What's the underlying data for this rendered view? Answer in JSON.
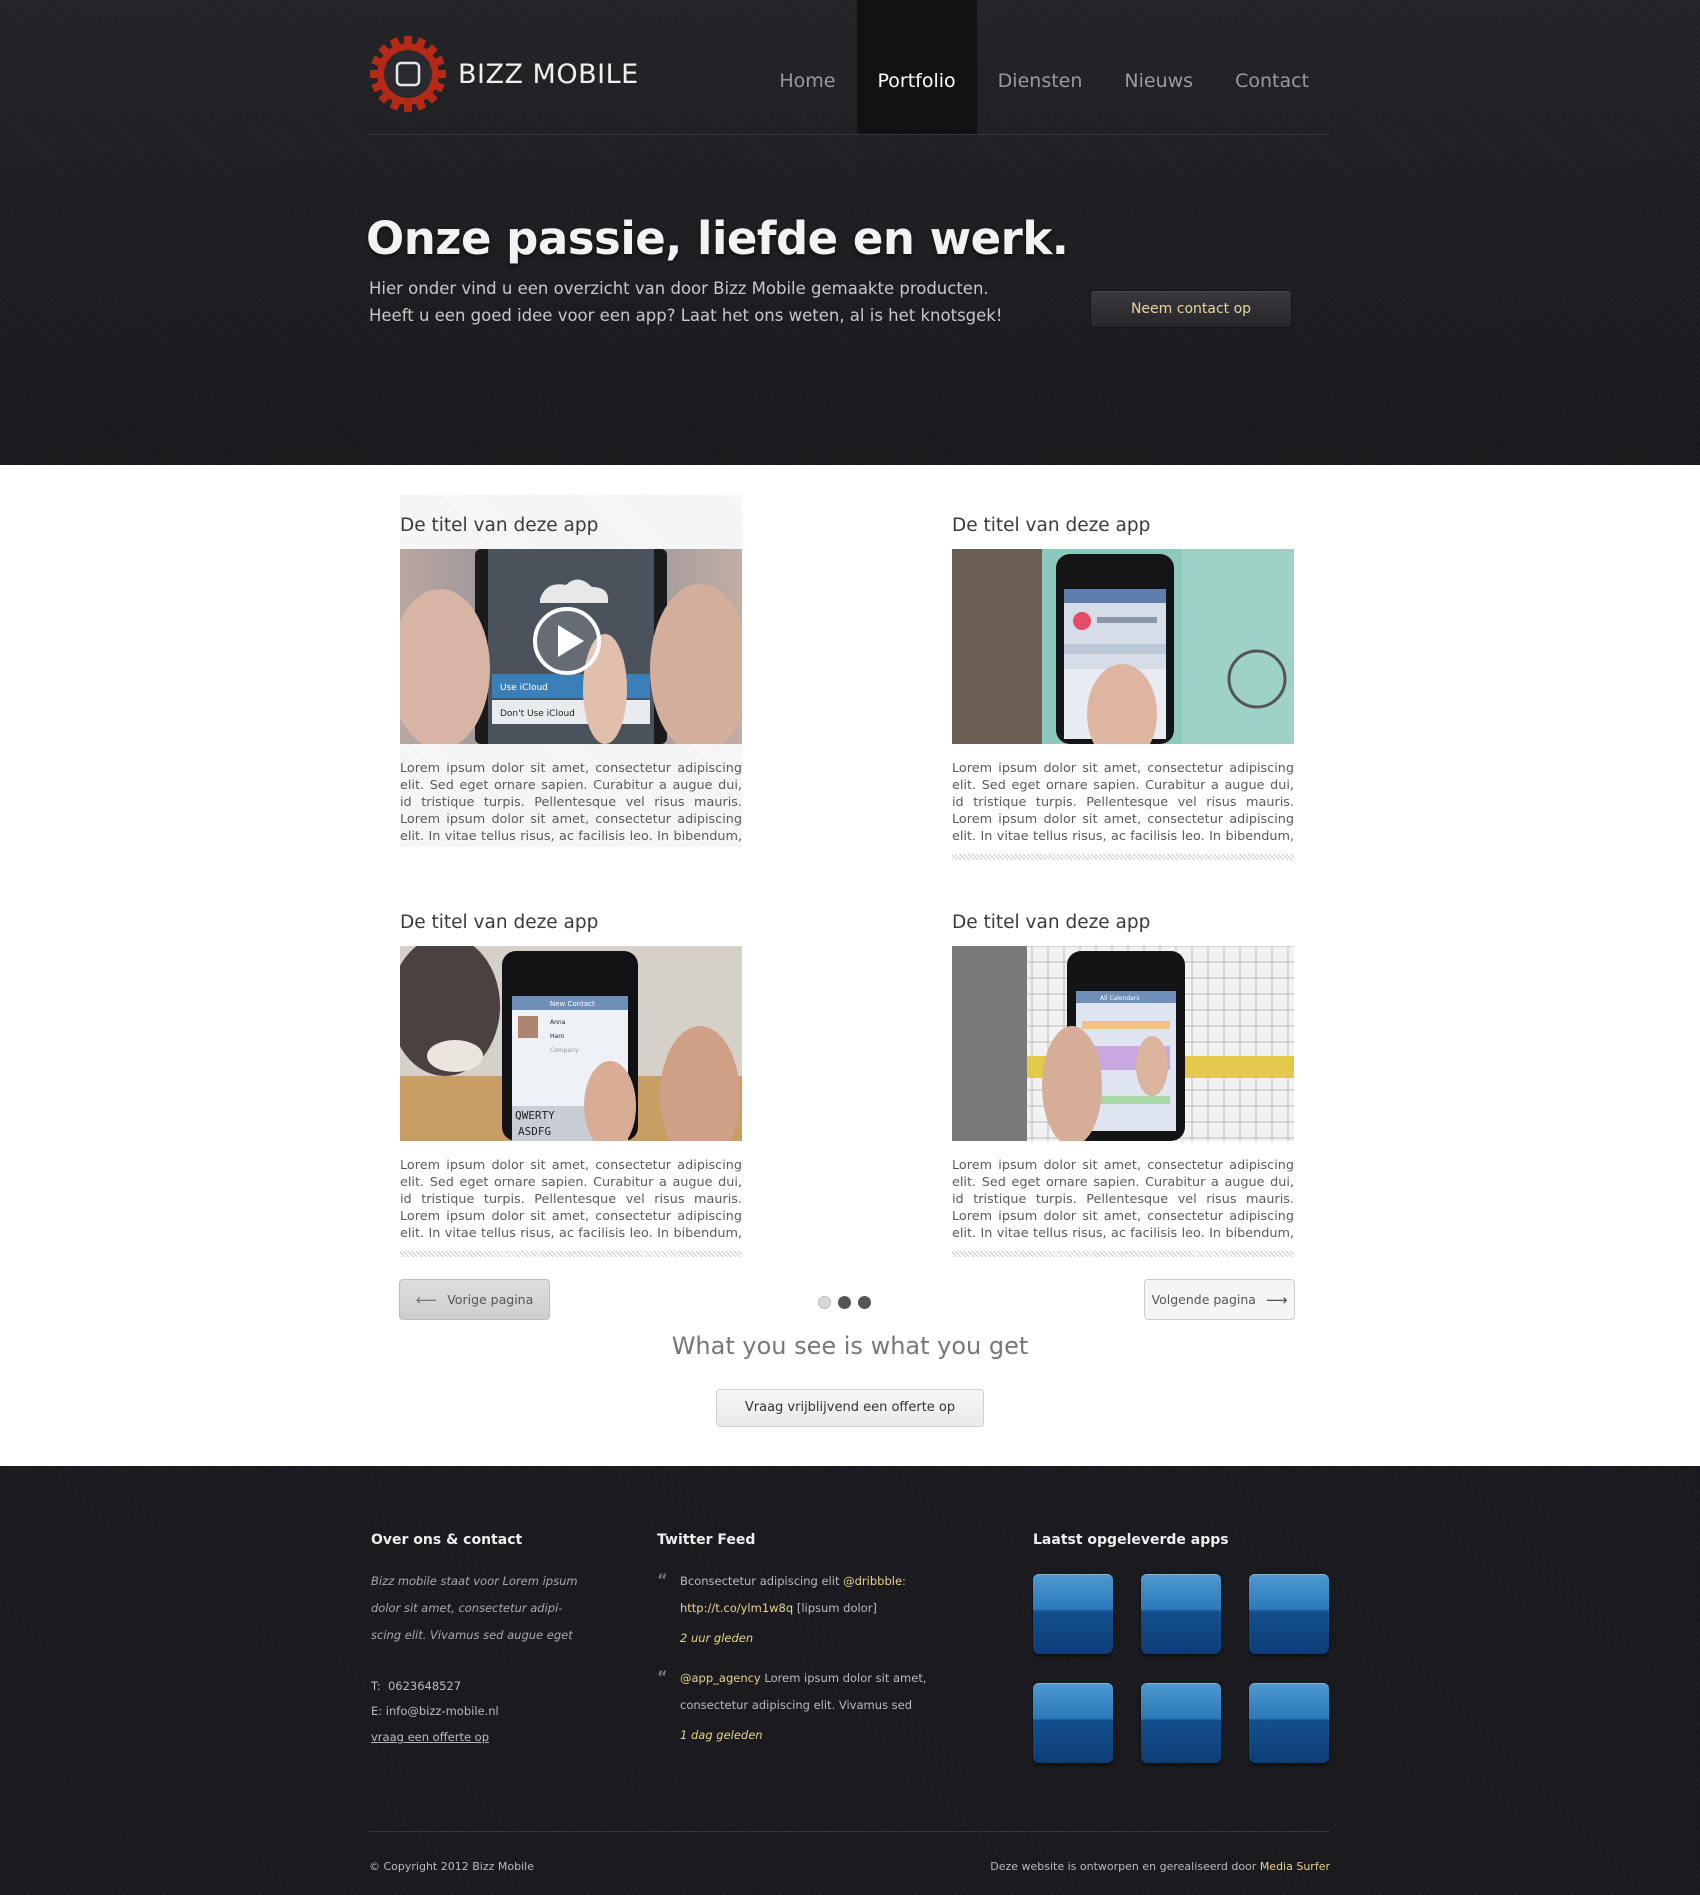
{
  "brand": {
    "name": "BIZZ MOBILE"
  },
  "nav": {
    "items": [
      "Home",
      "Portfolio",
      "Diensten",
      "Nieuws",
      "Contact"
    ],
    "active": "Portfolio"
  },
  "hero": {
    "title": "Onze passie, liefde en werk.",
    "line1": "Hier onder vind u een overzicht van door Bizz Mobile gemaakte producten.",
    "line2": "Heeft u een goed idee voor een app? Laat het ons weten, al is het knotsgek!",
    "cta": "Neem contact op"
  },
  "portfolio": {
    "cards": [
      {
        "title": "De titel van deze app",
        "text": "Lorem ipsum dolor sit amet, consectetur adipiscing elit. Sed eget ornare sapien. Curabitur a augue dui, id tristique turpis. Pellentesque vel risus mauris. Lorem ipsum dolor sit amet, consectetur adipiscing elit. In vitae tellus risus, ac facilisis leo. In bibendum, arcu id",
        "screen": [
          "Use iCloud",
          "Don't Use iCloud"
        ]
      },
      {
        "title": "De titel van deze app",
        "text": "Lorem ipsum dolor sit amet, consectetur adipiscing elit. Sed eget ornare sapien. Curabitur a augue dui, id tristique turpis. Pellentesque vel risus mauris. Lorem ipsum dolor sit amet, consectetur adipiscing elit. In vitae tellus risus, ac facilisis leo. In bibendum, arcu id"
      },
      {
        "title": "De titel van deze app",
        "text": "Lorem ipsum dolor sit amet, consectetur adipiscing elit. Sed eget ornare sapien. Curabitur a augue dui, id tristique turpis. Pellentesque vel risus mauris. Lorem ipsum dolor sit amet, consectetur adipiscing elit. In vitae tellus risus, ac facilisis leo. In bibendum, arcu id",
        "screen": [
          "New Contact",
          "Anna",
          "Haro",
          "Company",
          "QWERTY",
          "ASDFG"
        ]
      },
      {
        "title": "De titel van deze app",
        "text": "Lorem ipsum dolor sit amet, consectetur adipiscing elit. Sed eget ornare sapien. Curabitur a augue dui, id tristique turpis. Pellentesque vel risus mauris. Lorem ipsum dolor sit amet, consectetur adipiscing elit. In vitae tellus risus, ac facilisis leo. In bibendum, arcu id",
        "screen": [
          "All Calendars"
        ]
      }
    ],
    "prev": "Vorige pagina",
    "next": "Volgende pagina",
    "dots_active_index": 0,
    "tagline": "What you see is what you get",
    "quote_btn": "Vraag vrijblijvend een offerte op"
  },
  "footer": {
    "about": {
      "heading": "Over ons & contact",
      "lines": [
        "Bizz mobile staat voor Lorem ipsum",
        "dolor sit amet, consectetur adipi-",
        "scing elit. Vivamus sed augue eget"
      ],
      "phone_label": "T:",
      "phone": "0623648527",
      "email_label": "E:",
      "email": "info@bizz-mobile.nl",
      "link": "vraag een offerte op"
    },
    "twitter": {
      "heading": "Twitter Feed",
      "t1": {
        "text": "Bconsectetur adipiscing elit",
        "handle": "@dribbble",
        "colon": ":",
        "link": "http://t.co/ylm1w8q",
        "extra": "[lipsum dolor]",
        "time": "2 uur gleden"
      },
      "t2": {
        "handle": "@app_agency",
        "text": "Lorem ipsum dolor sit amet,",
        "text2": "consectetur adipiscing elit. Vivamus sed",
        "time": "1 dag geleden"
      }
    },
    "apps": {
      "heading": "Laatst opgeleverde apps"
    },
    "copyright": "© Copyright 2012 Bizz Mobile",
    "credit_prefix": "Deze website is ontworpen en gerealiseerd door",
    "credit_name": "Media Surfer"
  },
  "colors": {
    "accent": "#e6d28a",
    "logo_red": "#c8321e",
    "dark_bg": "#19191e"
  }
}
